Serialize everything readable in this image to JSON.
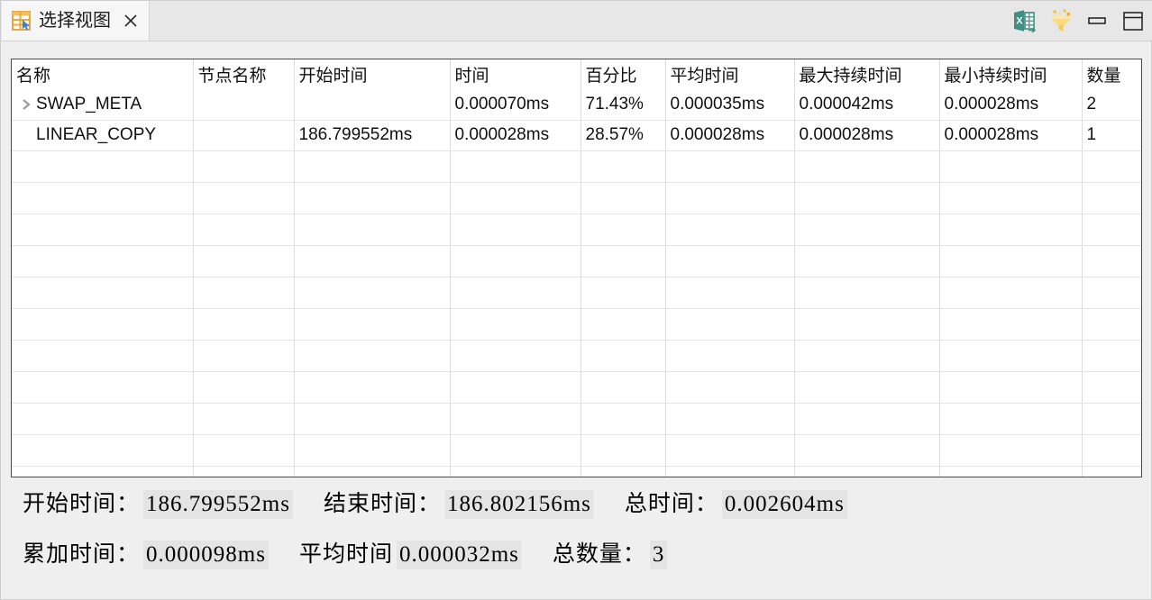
{
  "window": {
    "tab": {
      "title": "选择视图",
      "icon": "table-view-icon",
      "close_icon": "close-icon"
    },
    "actions": [
      {
        "name": "export-excel-button",
        "icon": "excel-export-icon"
      },
      {
        "name": "filter-button",
        "icon": "funnel-filter-icon"
      },
      {
        "name": "minimize-button",
        "icon": "minimize-icon"
      },
      {
        "name": "maximize-button",
        "icon": "maximize-icon"
      }
    ]
  },
  "table": {
    "columns": [
      "名称",
      "节点名称",
      "开始时间",
      "时间",
      "百分比",
      "平均时间",
      "最大持续时间",
      "最小持续时间",
      "数量"
    ],
    "rows": [
      {
        "expandable": true,
        "twisty": "chevron-right-icon",
        "name": "SWAP_META",
        "node_name": "",
        "start_time": "",
        "time": "0.000070ms",
        "percent": "71.43%",
        "avg_time": "0.000035ms",
        "max_duration": "0.000042ms",
        "min_duration": "0.000028ms",
        "count": "2"
      },
      {
        "expandable": false,
        "twisty": "",
        "name": "LINEAR_COPY",
        "node_name": "",
        "start_time": "186.799552ms",
        "time": "0.000028ms",
        "percent": "28.57%",
        "avg_time": "0.000028ms",
        "max_duration": "0.000028ms",
        "min_duration": "0.000028ms",
        "count": "1"
      }
    ],
    "blank_row_count": 11
  },
  "summary": {
    "row1": [
      {
        "label": "开始时间：",
        "value": "186.799552ms"
      },
      {
        "label": "结束时间：",
        "value": "186.802156ms"
      },
      {
        "label": "总时间：",
        "value": "0.002604ms"
      }
    ],
    "row2": [
      {
        "label": "累加时间：",
        "value": "0.000098ms"
      },
      {
        "label": "平均时间",
        "value": "0.000032ms"
      },
      {
        "label": "总数量：",
        "value": "3"
      }
    ]
  },
  "colors": {
    "tab_icon_orange": "#e8a93c",
    "tab_icon_blue": "#3f7fe0",
    "excel_green": "#3f8f82",
    "funnel_yellow": "#f3c13c",
    "value_highlight": "#e4e4e4"
  }
}
